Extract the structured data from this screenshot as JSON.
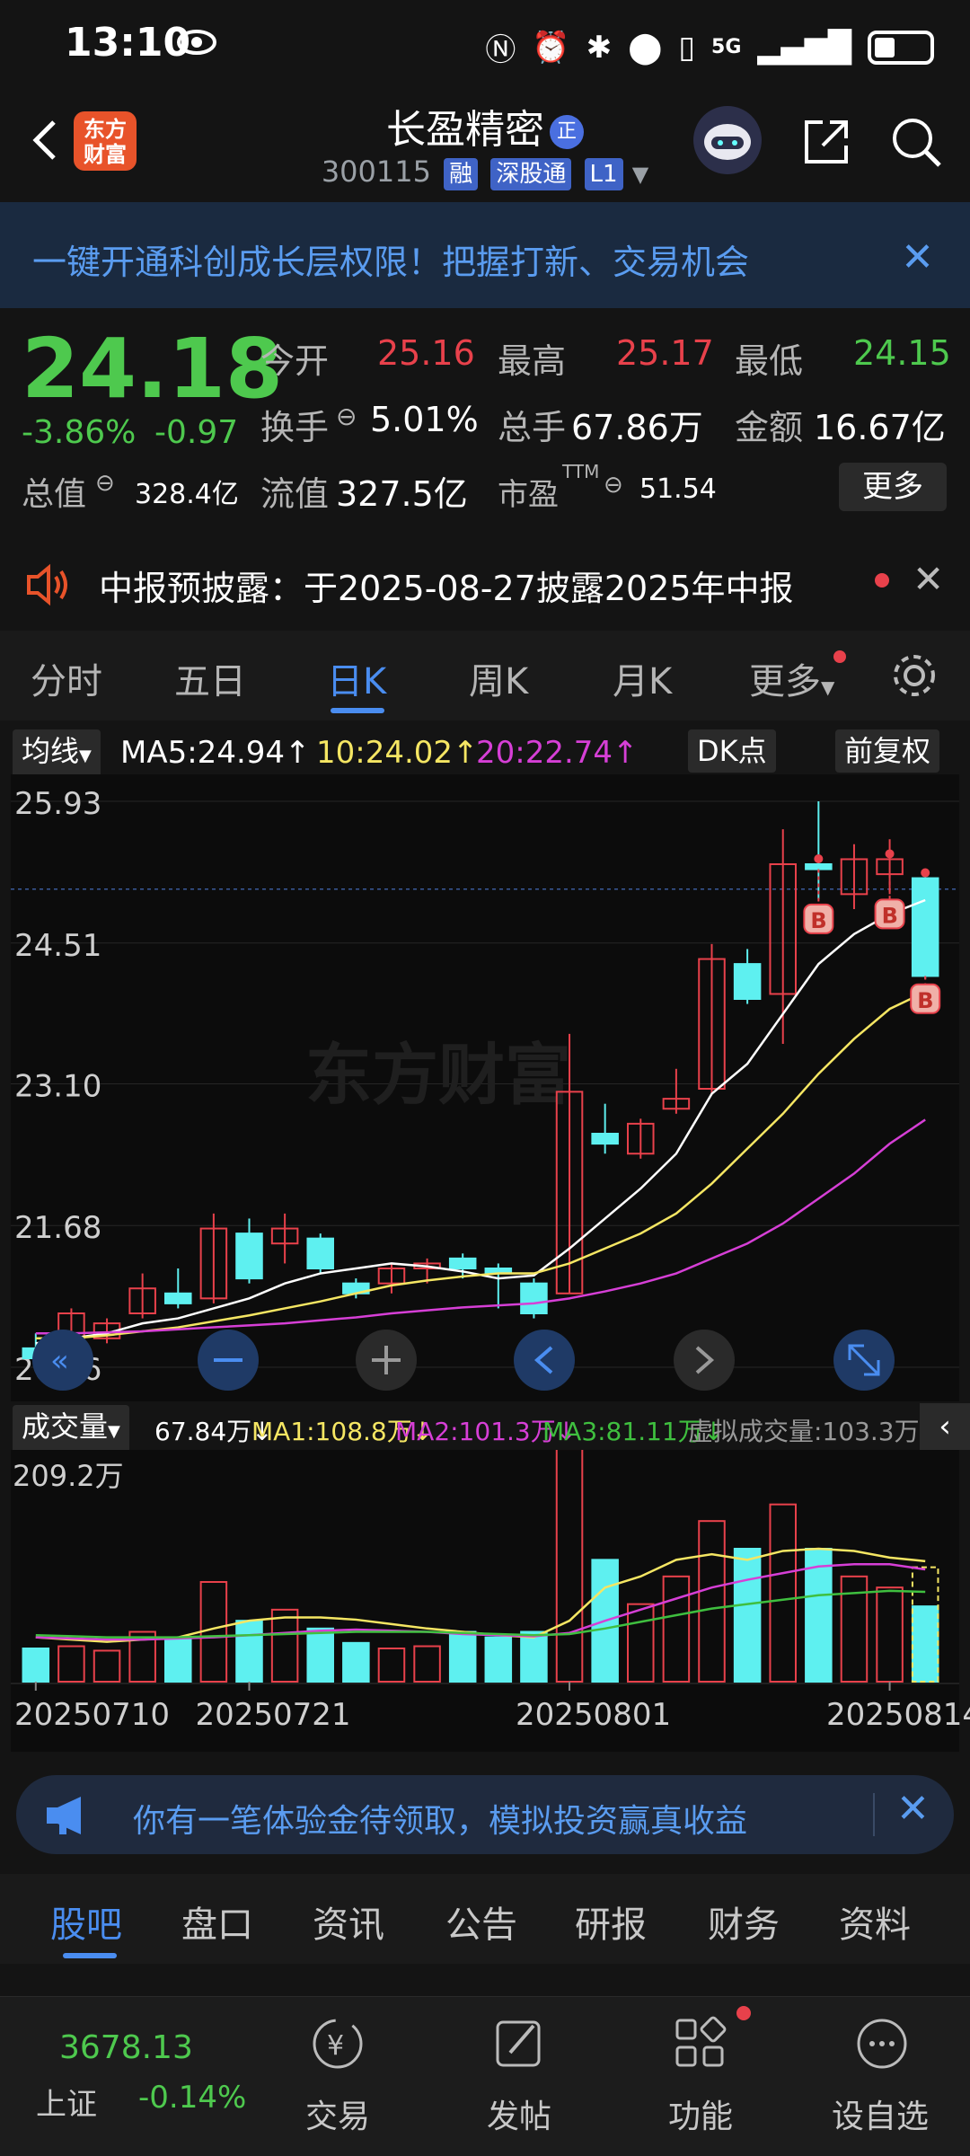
{
  "status": {
    "time": "13:10",
    "network": "5G"
  },
  "header": {
    "logo_line1": "东方",
    "logo_line2": "财富",
    "name": "长盈精密",
    "name_badge": "正",
    "code": "300115",
    "tag1": "融",
    "tag2": "深股通",
    "tag3": "L1"
  },
  "banner": {
    "text": "一键开通科创成长层权限！把握打新、交易机会"
  },
  "quote": {
    "price": "24.18",
    "change_pct": "-3.86%",
    "change": "-0.97",
    "open_label": "今开",
    "open": "25.16",
    "high_label": "最高",
    "high": "25.17",
    "low_label": "最低",
    "low": "24.15",
    "turnover_label": "换手",
    "turnover": "5.01%",
    "volume_label": "总手",
    "volume": "67.86万",
    "amount_label": "金额",
    "amount": "16.67亿",
    "mktcap_label": "总值",
    "mktcap": "328.4亿",
    "float_label": "流值",
    "float": "327.5亿",
    "pe_label": "市盈",
    "pe_sup": "TTM",
    "pe": "51.54",
    "more": "更多"
  },
  "notice": {
    "text": "中报预披露：于2025-08-27披露2025年中报"
  },
  "tabs": [
    "分时",
    "五日",
    "日K",
    "周K",
    "月K",
    "更多"
  ],
  "ma": {
    "label": "均线",
    "ma5": "MA5:24.94↑",
    "ma10": "10:24.02↑",
    "ma20": "20:22.74↑",
    "dk": "DK点",
    "fq": "前复权"
  },
  "vol": {
    "label": "成交量",
    "v": "67.84万↓",
    "ma1": "MA1:108.8万↓",
    "ma2": "MA2:101.3万↓",
    "ma3": "MA3:81.11万↓",
    "virt": "虚拟成交量:103.3万",
    "max": "209.2万"
  },
  "colors": {
    "up": "#e8414b",
    "down": "#5ef0f0",
    "ma5": "#ffffff",
    "ma10": "#f5e663",
    "ma20": "#d63fd6",
    "accent": "#4a8df0"
  },
  "chart_data": {
    "type": "candlestick",
    "y_ticks": [
      "25.93",
      "24.51",
      "23.10",
      "21.68",
      "20.26"
    ],
    "ylim": [
      20.26,
      25.93
    ],
    "x_labels": [
      "20250710",
      "20250721",
      "20250801",
      "20250814"
    ],
    "watermark": "东方财富",
    "candles": [
      {
        "o": 20.45,
        "h": 20.6,
        "l": 20.3,
        "c": 20.35
      },
      {
        "o": 20.5,
        "h": 20.85,
        "l": 20.45,
        "c": 20.8
      },
      {
        "o": 20.55,
        "h": 20.75,
        "l": 20.5,
        "c": 20.7
      },
      {
        "o": 20.8,
        "h": 21.2,
        "l": 20.75,
        "c": 21.05
      },
      {
        "o": 21.0,
        "h": 21.25,
        "l": 20.85,
        "c": 20.9
      },
      {
        "o": 20.95,
        "h": 21.8,
        "l": 20.9,
        "c": 21.65
      },
      {
        "o": 21.6,
        "h": 21.75,
        "l": 21.1,
        "c": 21.15
      },
      {
        "o": 21.5,
        "h": 21.8,
        "l": 21.3,
        "c": 21.65
      },
      {
        "o": 21.55,
        "h": 21.6,
        "l": 21.2,
        "c": 21.25
      },
      {
        "o": 21.1,
        "h": 21.15,
        "l": 20.95,
        "c": 21.0
      },
      {
        "o": 21.1,
        "h": 21.3,
        "l": 21.0,
        "c": 21.25
      },
      {
        "o": 21.25,
        "h": 21.35,
        "l": 21.1,
        "c": 21.3
      },
      {
        "o": 21.35,
        "h": 21.4,
        "l": 21.15,
        "c": 21.25
      },
      {
        "o": 21.25,
        "h": 21.3,
        "l": 20.85,
        "c": 21.2
      },
      {
        "o": 21.1,
        "h": 21.15,
        "l": 20.75,
        "c": 20.8
      },
      {
        "o": 21.0,
        "h": 23.6,
        "l": 21.0,
        "c": 23.02
      },
      {
        "o": 22.6,
        "h": 22.9,
        "l": 22.4,
        "c": 22.5
      },
      {
        "o": 22.4,
        "h": 22.75,
        "l": 22.35,
        "c": 22.7
      },
      {
        "o": 22.85,
        "h": 23.25,
        "l": 22.8,
        "c": 22.95
      },
      {
        "o": 23.05,
        "h": 24.5,
        "l": 23.0,
        "c": 24.35
      },
      {
        "o": 24.3,
        "h": 24.45,
        "l": 23.9,
        "c": 23.95
      },
      {
        "o": 24.0,
        "h": 25.65,
        "l": 23.5,
        "c": 25.3
      },
      {
        "o": 25.3,
        "h": 25.93,
        "l": 24.95,
        "c": 25.25
      },
      {
        "o": 25.0,
        "h": 25.5,
        "l": 24.85,
        "c": 25.35
      },
      {
        "o": 25.2,
        "h": 25.55,
        "l": 25.0,
        "c": 25.35
      },
      {
        "o": 25.16,
        "h": 25.17,
        "l": 24.15,
        "c": 24.18
      }
    ],
    "ma5": [
      20.5,
      20.55,
      20.6,
      20.7,
      20.75,
      20.85,
      20.95,
      21.1,
      21.2,
      21.25,
      21.3,
      21.27,
      21.22,
      21.15,
      21.18,
      21.45,
      21.75,
      22.05,
      22.4,
      23.0,
      23.3,
      23.8,
      24.3,
      24.6,
      24.8,
      24.94
    ],
    "ma10": [
      20.55,
      20.55,
      20.58,
      20.62,
      20.66,
      20.72,
      20.78,
      20.85,
      20.92,
      21.0,
      21.08,
      21.13,
      21.17,
      21.2,
      21.2,
      21.3,
      21.45,
      21.6,
      21.8,
      22.1,
      22.45,
      22.8,
      23.2,
      23.55,
      23.85,
      24.02
    ],
    "ma20": [
      20.6,
      20.6,
      20.61,
      20.62,
      20.64,
      20.66,
      20.68,
      20.7,
      20.73,
      20.76,
      20.8,
      20.83,
      20.86,
      20.88,
      20.9,
      20.95,
      21.02,
      21.1,
      21.2,
      21.35,
      21.5,
      21.7,
      21.95,
      22.2,
      22.5,
      22.74
    ],
    "b_marks": [
      22,
      24,
      25
    ],
    "volumes": [
      30,
      32,
      28,
      45,
      40,
      90,
      55,
      65,
      48,
      35,
      30,
      32,
      45,
      40,
      45,
      210,
      110,
      70,
      95,
      145,
      120,
      160,
      120,
      95,
      85,
      68
    ],
    "vol_ylim": [
      0,
      209.2
    ],
    "vol_ma1": [
      40,
      38,
      36,
      38,
      40,
      48,
      55,
      58,
      58,
      56,
      52,
      48,
      45,
      42,
      40,
      55,
      85,
      95,
      110,
      115,
      110,
      118,
      120,
      118,
      112,
      108.8
    ],
    "vol_ma2": [
      40,
      39,
      38,
      38,
      39,
      40,
      42,
      44,
      46,
      47,
      46,
      45,
      43,
      42,
      41,
      44,
      55,
      65,
      75,
      85,
      92,
      98,
      104,
      106,
      106,
      101.3
    ],
    "vol_ma3": [
      42,
      41,
      40,
      40,
      40,
      41,
      42,
      43,
      44,
      45,
      45,
      45,
      44,
      43,
      42,
      43,
      48,
      54,
      60,
      66,
      70,
      74,
      78,
      80,
      82,
      81.11
    ]
  },
  "promo": {
    "text": "你有一笔体验金待领取，模拟投资赢真收益"
  },
  "bottom_tabs": [
    "股吧",
    "盘口",
    "资讯",
    "公告",
    "研报",
    "财务",
    "资料"
  ],
  "bottom_nav": {
    "index_value": "3678.13",
    "index_name": "上证",
    "index_chg": "-0.14%",
    "trade": "交易",
    "post": "发帖",
    "func": "功能",
    "watch": "设自选"
  }
}
